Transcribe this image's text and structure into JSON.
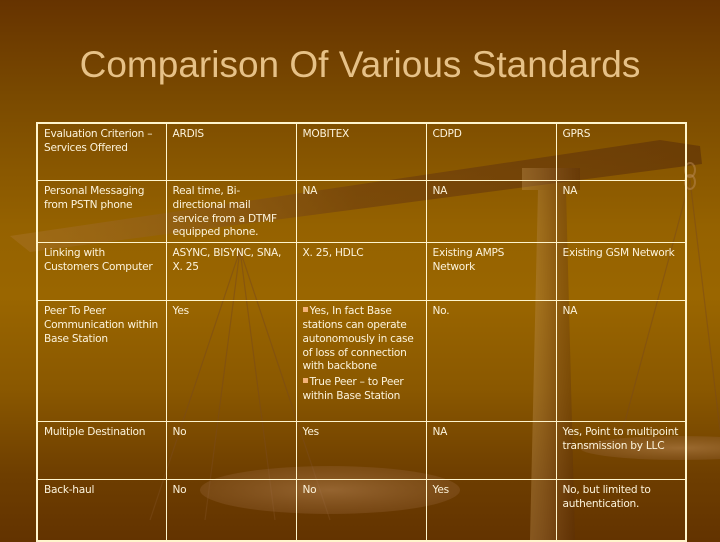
{
  "slide": {
    "title": "Comparison Of Various Standards",
    "background_top": "#663300",
    "background_mid": "#9a6600",
    "title_color": "#e6c187",
    "border_color": "#fff5cc",
    "bullet_color": "#f2b277",
    "decoration": "balance-scale-icon"
  },
  "table": {
    "headers": [
      "Evaluation Criterion – Services Offered",
      "ARDIS",
      "MOBITEX",
      "CDPD",
      "GPRS"
    ],
    "rows": [
      {
        "criterion": "Personal Messaging from PSTN phone",
        "ardis": "Real time, Bi-directional mail service from a DTMF equipped phone.",
        "mobitex": "NA",
        "cdpd": "NA",
        "gprs": "NA"
      },
      {
        "criterion": "Linking with Customers Computer",
        "ardis": "ASYNC, BISYNC, SNA, X. 25",
        "mobitex": "X. 25, HDLC",
        "cdpd": "Existing AMPS Network",
        "gprs": "Existing GSM Network"
      },
      {
        "criterion": "Peer To Peer Communication within Base Station",
        "ardis": "Yes",
        "mobitex_bullets": [
          "Yes, In fact Base stations can operate autonomously in case of loss of connection with backbone",
          "True Peer – to Peer within Base Station"
        ],
        "cdpd": "No.",
        "gprs": "NA"
      },
      {
        "criterion": "Multiple Destination",
        "ardis": "No",
        "mobitex": "Yes",
        "cdpd": "NA",
        "gprs": "Yes, Point to multipoint transmission by LLC"
      },
      {
        "criterion": "Back-haul",
        "ardis": "No",
        "mobitex": "No",
        "cdpd": "Yes",
        "gprs": "No, but limited to authentication."
      }
    ]
  }
}
